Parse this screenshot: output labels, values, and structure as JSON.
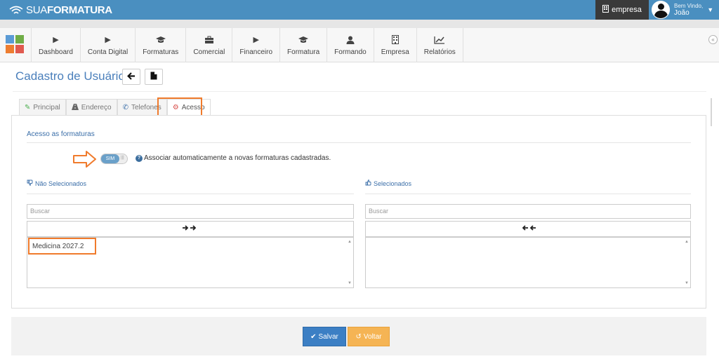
{
  "app": {
    "brand_part1": "SUA",
    "brand_part2": "FORMATURA",
    "company": "empresa",
    "welcome": "Bem Vindo,",
    "user_name": "João"
  },
  "nav": {
    "items": [
      {
        "label": "Dashboard",
        "icon": "play-icon"
      },
      {
        "label": "Conta Digital",
        "icon": "play-icon"
      },
      {
        "label": "Formaturas",
        "icon": "graduation-cap-icon"
      },
      {
        "label": "Comercial",
        "icon": "briefcase-icon"
      },
      {
        "label": "Financeiro",
        "icon": "play-icon"
      },
      {
        "label": "Formatura",
        "icon": "graduation-cap-icon"
      },
      {
        "label": "Formando",
        "icon": "user-icon"
      },
      {
        "label": "Empresa",
        "icon": "building-icon"
      },
      {
        "label": "Relatórios",
        "icon": "line-chart-icon"
      }
    ]
  },
  "page": {
    "title": "Cadastro de Usuário"
  },
  "tabs": [
    {
      "label": "Principal",
      "icon": "edit-icon",
      "active": false
    },
    {
      "label": "Endereço",
      "icon": "road-icon",
      "active": false
    },
    {
      "label": "Telefones",
      "icon": "phone-icon",
      "active": false
    },
    {
      "label": "Acesso",
      "icon": "cogs-icon",
      "active": true
    }
  ],
  "access": {
    "section_title": "Acesso as formaturas",
    "toggle_label": "SIM",
    "toggle_on": true,
    "assoc_text": "Associar automaticamente a novas formaturas cadastradas.",
    "left_label": "Não Selecionados",
    "right_label": "Selecionados",
    "left_search_placeholder": "Buscar",
    "right_search_placeholder": "Buscar",
    "left_items": [
      "Medicina 2027.2"
    ],
    "right_items": []
  },
  "footer": {
    "save_label": "Salvar",
    "back_label": "Voltar"
  },
  "colors": {
    "topbar": "#4a8fc0",
    "primary": "#3c7fc4",
    "warning": "#f5b454",
    "highlight": "#f07b2c",
    "link": "#3a6ea8"
  }
}
